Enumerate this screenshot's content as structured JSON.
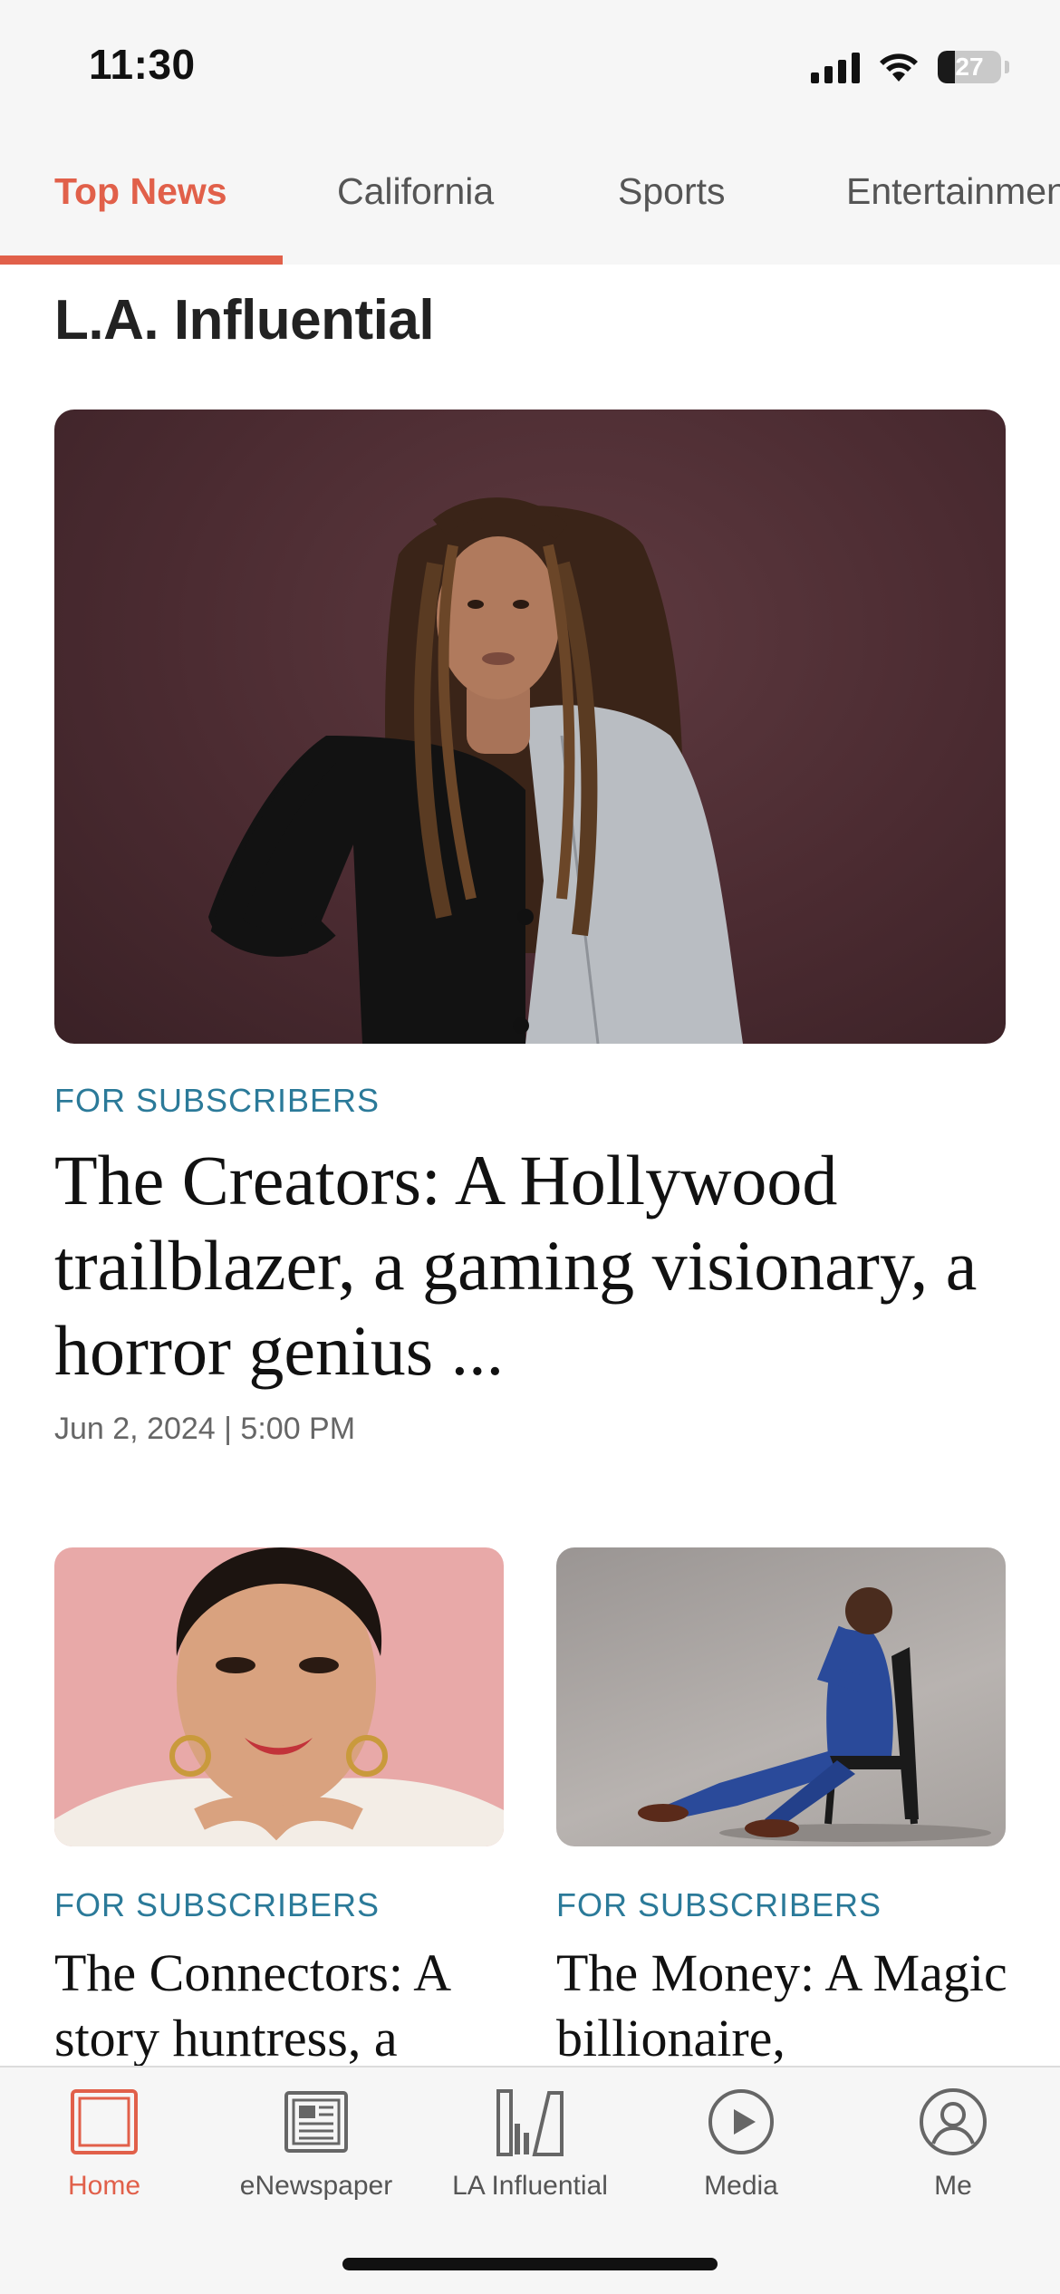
{
  "status_bar": {
    "time": "11:30",
    "battery_level": "27"
  },
  "tabs": [
    {
      "label": "Top News",
      "active": true
    },
    {
      "label": "California",
      "active": false
    },
    {
      "label": "Sports",
      "active": false
    },
    {
      "label": "Entertainment",
      "active": false
    }
  ],
  "section_title": "L.A. Influential",
  "lead_story": {
    "kicker": "FOR SUBSCRIBERS",
    "headline": "The Creators: A Hollywood trailblazer, a gaming visionary, a horror genius ...",
    "timestamp": "Jun 2, 2024 | 5:00 PM"
  },
  "cards": [
    {
      "kicker": "FOR SUBSCRIBERS",
      "headline": "The Connectors: A story huntress, a"
    },
    {
      "kicker": "FOR SUBSCRIBERS",
      "headline": "The Money: A Magic billionaire,"
    }
  ],
  "bottom_nav": [
    {
      "label": "Home",
      "icon": "home-icon",
      "active": true
    },
    {
      "label": "eNewspaper",
      "icon": "newspaper-icon",
      "active": false
    },
    {
      "label": "LA Influential",
      "icon": "la-influential-icon",
      "active": false
    },
    {
      "label": "Media",
      "icon": "play-icon",
      "active": false
    },
    {
      "label": "Me",
      "icon": "profile-icon",
      "active": false
    }
  ],
  "colors": {
    "accent": "#e1604a",
    "kicker": "#2b7a99",
    "chrome_background": "#f6f6f6"
  }
}
